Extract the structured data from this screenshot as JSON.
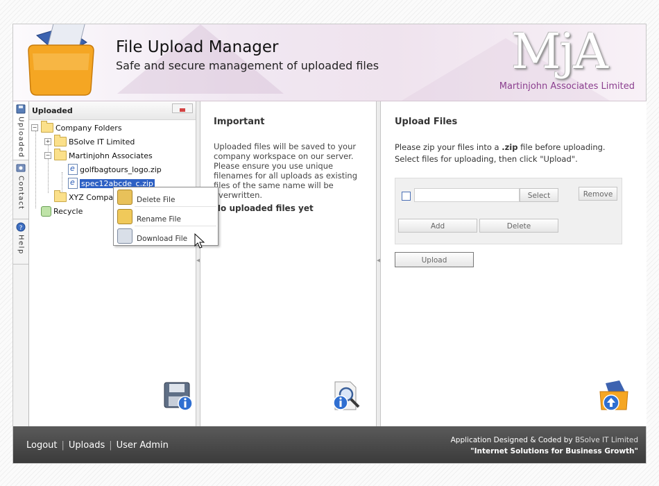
{
  "header": {
    "title": "File Upload Manager",
    "subtitle": "Safe and secure management of uploaded files",
    "logo_mark": "MjA",
    "company": "Martinjohn Associates Limited"
  },
  "side_tabs": [
    {
      "label": "Uploaded"
    },
    {
      "label": "Contact"
    },
    {
      "label": "Help"
    }
  ],
  "tree": {
    "heading": "Uploaded",
    "nodes": [
      {
        "label": "Company Folders"
      },
      {
        "label": "BSolve IT Limited"
      },
      {
        "label": "Martinjohn Associates"
      },
      {
        "label": "golfbagtours_logo.zip"
      },
      {
        "label": "spec12abcde_c.zip"
      },
      {
        "label": "XYZ Company"
      },
      {
        "label": "Recycle"
      }
    ]
  },
  "context_menu": {
    "items": [
      {
        "label": "Delete File"
      },
      {
        "label": "Rename File"
      },
      {
        "label": "Download File"
      }
    ]
  },
  "middle": {
    "heading": "Important",
    "body": "Uploaded files will be saved to your company workspace on our server. Please ensure you use unique filenames for all uploads as existing files of the same name will be overwritten.",
    "no_files": "No uploaded files yet"
  },
  "upload": {
    "heading": "Upload Files",
    "line1_pre": "Please zip your files into a ",
    "line1_bold": ".zip",
    "line1_post": " file before uploading.",
    "line2": "Select files for uploading, then click \"Upload\".",
    "select_label": "Select",
    "remove_label": "Remove",
    "add_label": "Add",
    "delete_label": "Delete",
    "upload_label": "Upload"
  },
  "footer": {
    "links": [
      "Logout",
      "Uploads",
      "User Admin"
    ],
    "designed_pre": "Application Designed & Coded by ",
    "designed_company": "BSolve IT Limited",
    "tagline": "\"Internet Solutions for Business Growth\""
  },
  "colors": {
    "accent_purple": "#8b3f8f",
    "selection_blue": "#2d60c4",
    "footer_bg": "#4a4a4a"
  }
}
